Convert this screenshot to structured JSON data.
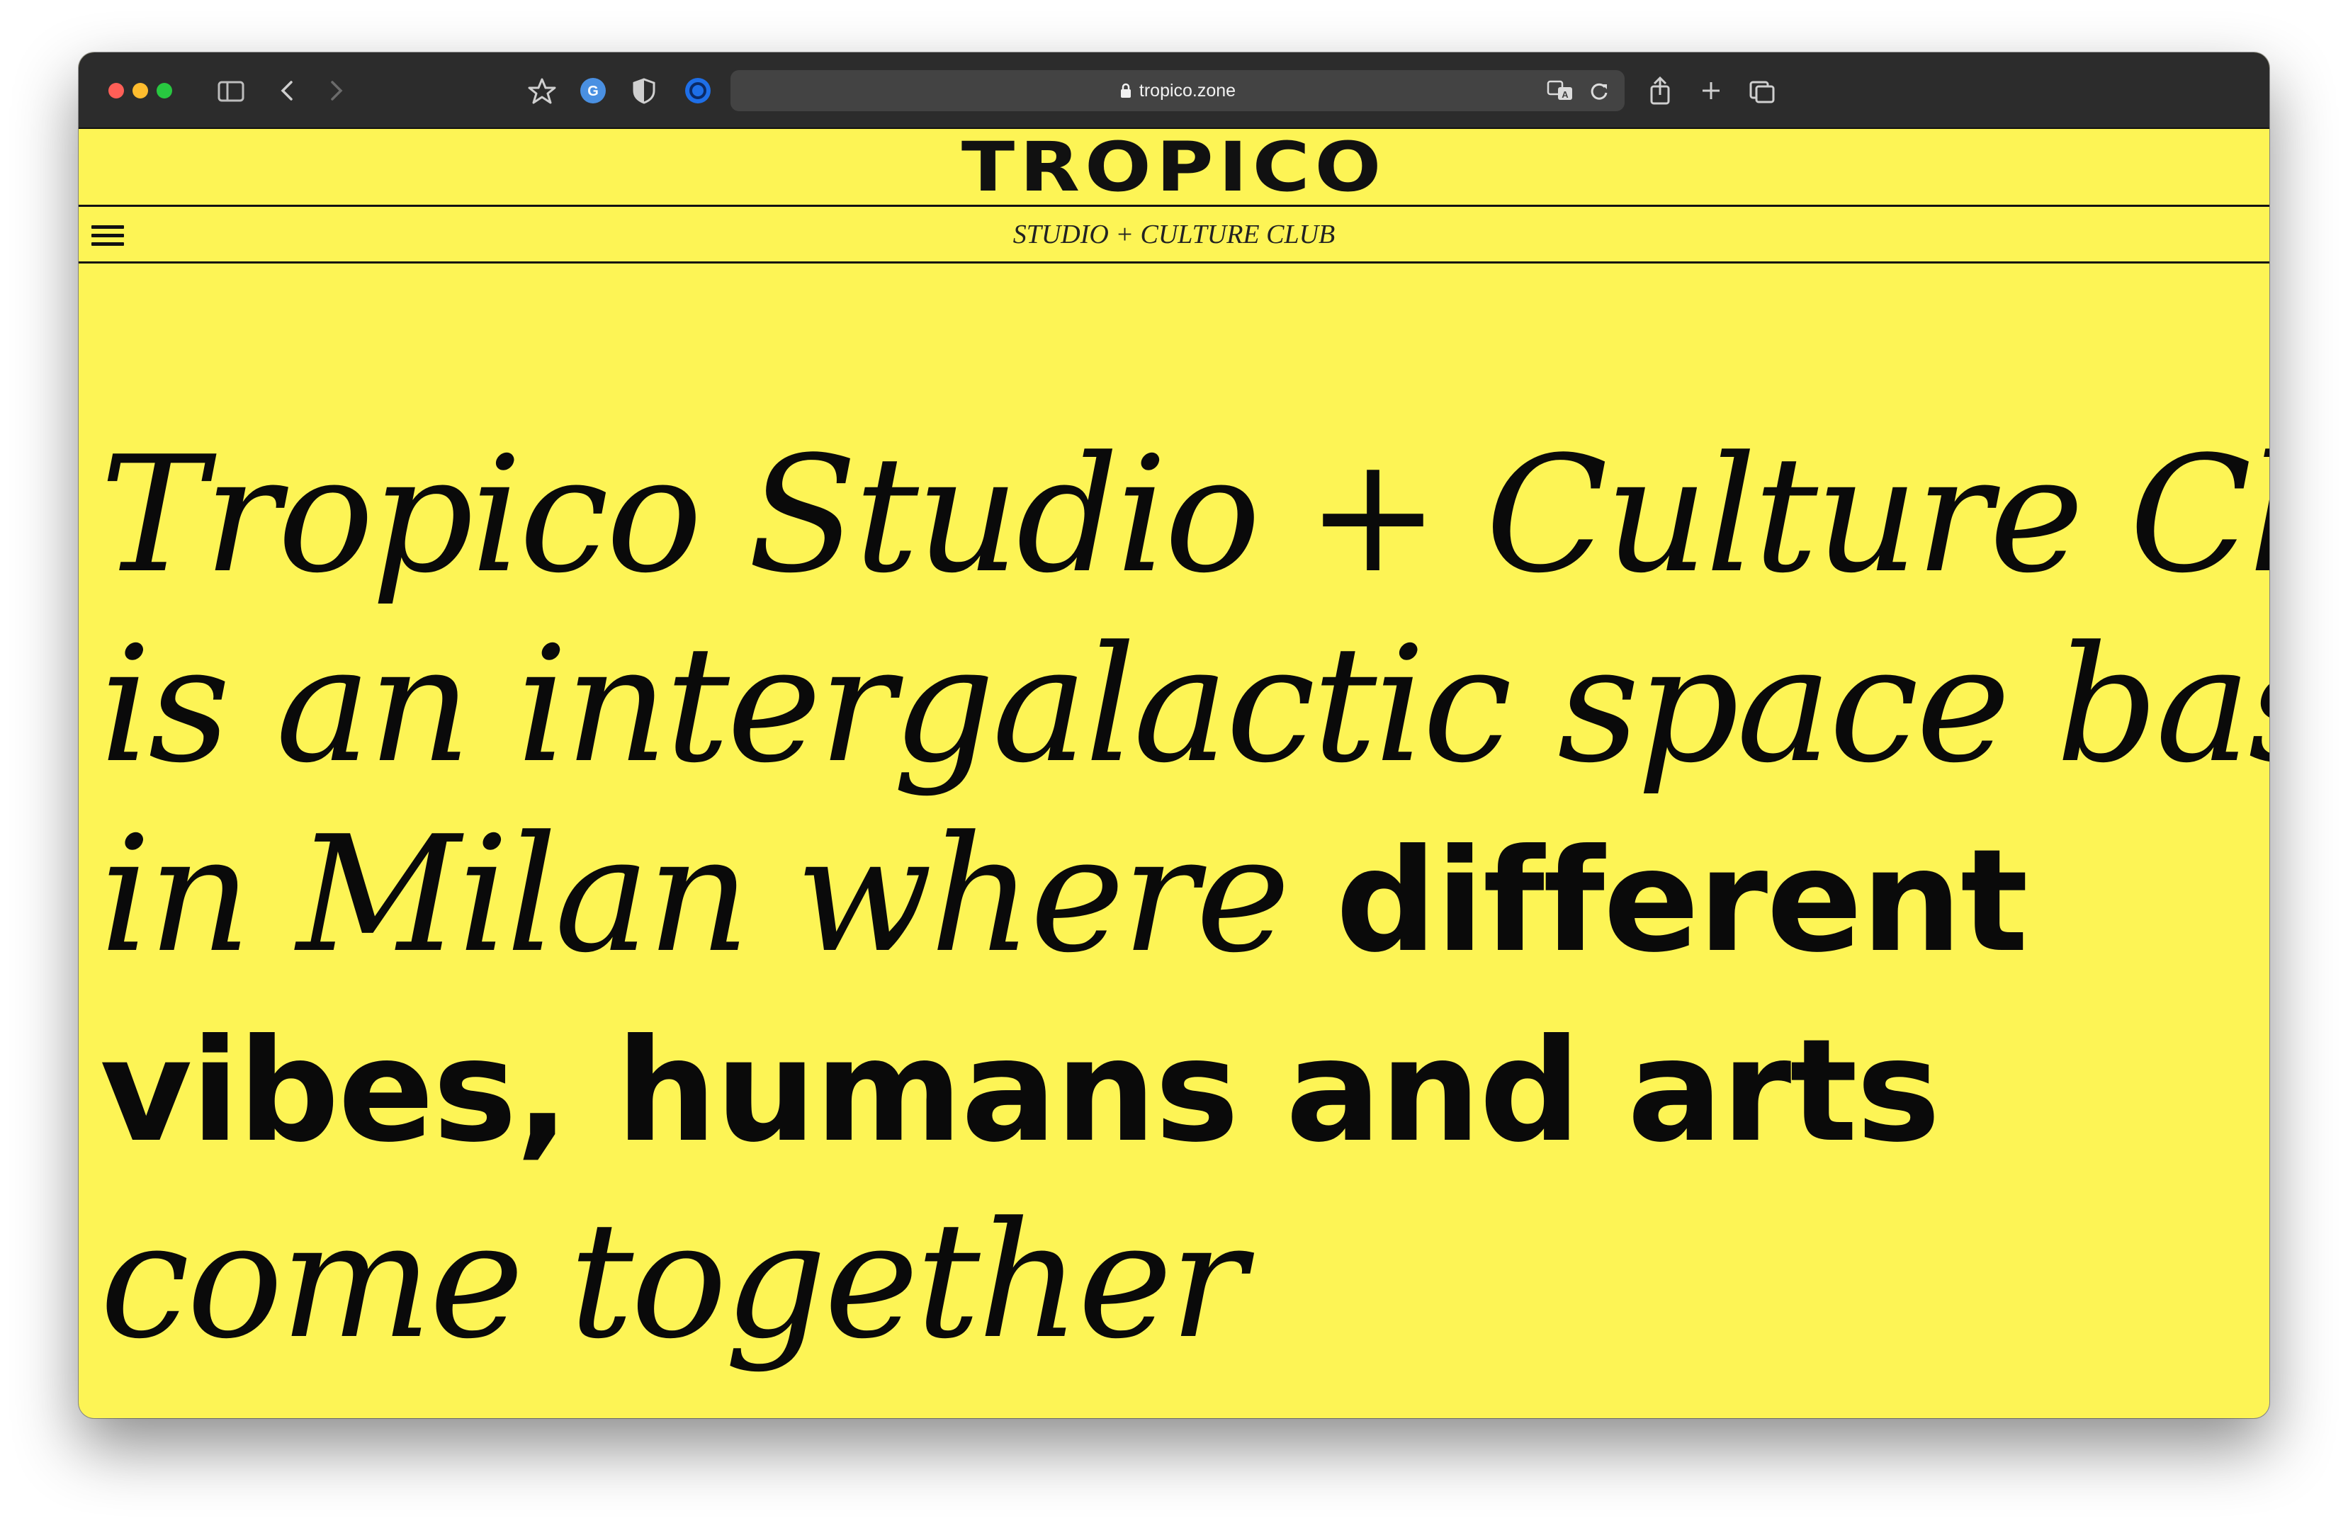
{
  "browser": {
    "url": "tropico.zone",
    "icons": [
      "sidebar-icon",
      "back-icon",
      "forward-icon",
      "star-icon",
      "grammarly-icon",
      "shield-icon",
      "extension-icon",
      "lock-icon",
      "translate-icon",
      "reload-icon",
      "share-icon",
      "new-tab-icon",
      "tabs-overview-icon"
    ]
  },
  "site": {
    "logo": "TROPICO",
    "subtitle": "STUDIO + CULTURE CLUB",
    "hero": {
      "line1": "Tropico Studio + Culture Club",
      "line2": "is an intergalactic space based",
      "line3_italic": "in Milan where ",
      "line3_bold": "different",
      "line4_bold": "vibes, humans and arts",
      "line5": "come together"
    }
  },
  "colors": {
    "background": "#fdf455",
    "text": "#0a0a0a",
    "toolbar": "#2c2c2c"
  }
}
